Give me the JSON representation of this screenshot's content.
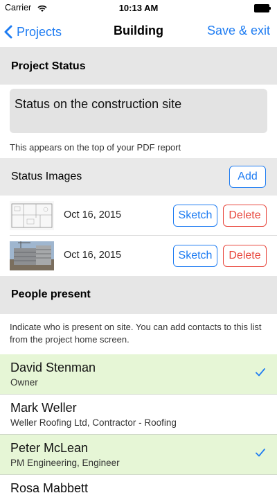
{
  "status_bar": {
    "carrier": "Carrier",
    "time": "10:13 AM"
  },
  "nav": {
    "back_label": "Projects",
    "title": "Building",
    "right_label": "Save & exit"
  },
  "project_status": {
    "header": "Project Status",
    "input_value": "Status on the construction site",
    "caption": "This appears on the top of your PDF report"
  },
  "status_images": {
    "header": "Status Images",
    "add_label": "Add",
    "items": [
      {
        "date": "Oct 16, 2015",
        "thumb": "floor-plan-sketch",
        "sketch_label": "Sketch",
        "delete_label": "Delete"
      },
      {
        "date": "Oct 16, 2015",
        "thumb": "building-photo",
        "sketch_label": "Sketch",
        "delete_label": "Delete"
      }
    ]
  },
  "people": {
    "header": "People present",
    "caption": "Indicate who is present on site. You can add contacts to this list from the project home screen.",
    "items": [
      {
        "name": "David Stenman",
        "role": "Owner",
        "selected": true
      },
      {
        "name": "Mark Weller",
        "role": "Weller Roofing Ltd, Contractor - Roofing",
        "selected": false
      },
      {
        "name": "Peter McLean",
        "role": "PM Engineering, Engineer",
        "selected": true
      },
      {
        "name": "Rosa Mabbett",
        "role": "",
        "selected": false
      }
    ]
  },
  "colors": {
    "accent": "#1e7cf2",
    "danger": "#e8463c",
    "selected_row": "#e6f6d6",
    "section_header": "#e6e6e6"
  },
  "icons": {
    "back": "chevron-left-icon",
    "wifi": "wifi-icon",
    "battery": "battery-icon",
    "check": "checkmark-icon"
  }
}
